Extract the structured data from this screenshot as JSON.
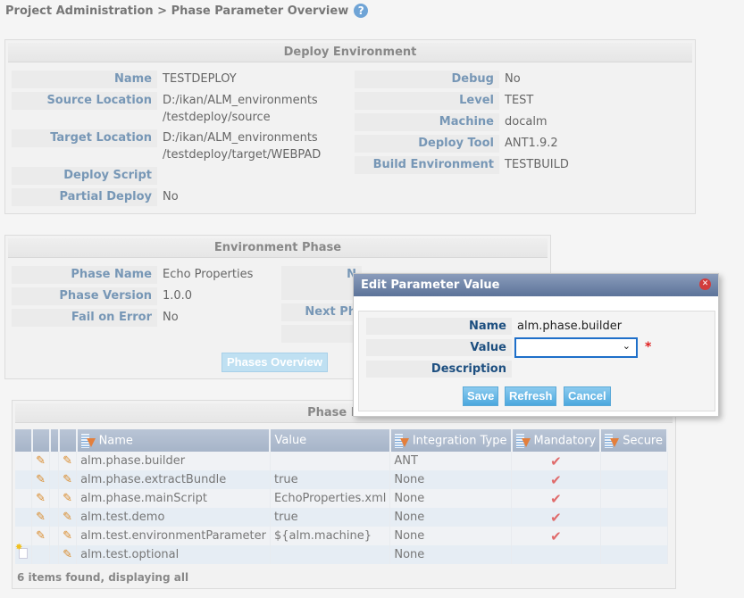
{
  "breadcrumb": {
    "text": "Project Administration > Phase Parameter Overview",
    "help_icon": "help-icon"
  },
  "deploy_env": {
    "title": "Deploy Environment",
    "left": [
      {
        "label": "Name",
        "value": "TESTDEPLOY"
      },
      {
        "label": "Source Location",
        "value": "D:/ikan/ALM_environments",
        "value2": "/testdeploy/source"
      },
      {
        "label": "Target Location",
        "value": "D:/ikan/ALM_environments",
        "value2": "/testdeploy/target/WEBPAD"
      },
      {
        "label": "Deploy Script",
        "value": ""
      },
      {
        "label": "Partial Deploy",
        "value": "No"
      }
    ],
    "right": [
      {
        "label": "Debug",
        "value": "No"
      },
      {
        "label": "Level",
        "value": "TEST"
      },
      {
        "label": "Machine",
        "value": "docalm"
      },
      {
        "label": "Deploy Tool",
        "value": "ANT1.9.2"
      },
      {
        "label": "Build Environment",
        "value": "TESTBUILD"
      }
    ]
  },
  "env_phase": {
    "title": "Environment Phase",
    "left": [
      {
        "label": "Phase Name",
        "value": "Echo Properties"
      },
      {
        "label": "Phase Version",
        "value": "1.0.0"
      },
      {
        "label": "Fail on Error",
        "value": "No"
      }
    ],
    "right_partial": [
      {
        "label": "N"
      },
      {
        "label": "Next Ph"
      }
    ],
    "phases_overview_button": "Phases Overview"
  },
  "phase_params": {
    "title": "Phase Para",
    "columns": [
      "",
      "",
      "",
      "",
      "Name",
      "Value",
      "Integration Type",
      "Mandatory",
      "Secure"
    ],
    "rows": [
      {
        "name": "alm.phase.builder",
        "value": "",
        "integration": "ANT",
        "mandatory": true,
        "editable": true,
        "new": false
      },
      {
        "name": "alm.phase.extractBundle",
        "value": "true",
        "integration": "None",
        "mandatory": true,
        "editable": true,
        "new": false
      },
      {
        "name": "alm.phase.mainScript",
        "value": "EchoProperties.xml",
        "integration": "None",
        "mandatory": true,
        "editable": true,
        "new": false
      },
      {
        "name": "alm.test.demo",
        "value": "true",
        "integration": "None",
        "mandatory": true,
        "editable": true,
        "new": false
      },
      {
        "name": "alm.test.environmentParameter",
        "value": "${alm.machine}",
        "integration": "None",
        "mandatory": true,
        "editable": true,
        "new": false
      },
      {
        "name": "alm.test.optional",
        "value": "",
        "integration": "None",
        "mandatory": false,
        "editable": false,
        "new": true
      }
    ],
    "footer": "6 items found, displaying all",
    "check_glyph": "✔",
    "pencil_glyph": "✎"
  },
  "dialog": {
    "title": "Edit Parameter Value",
    "name_label": "Name",
    "name_value": "alm.phase.builder",
    "value_label": "Value",
    "value_selected": "",
    "required_mark": "*",
    "description_label": "Description",
    "buttons": {
      "save": "Save",
      "refresh": "Refresh",
      "cancel": "Cancel"
    },
    "close_glyph": "✕"
  }
}
